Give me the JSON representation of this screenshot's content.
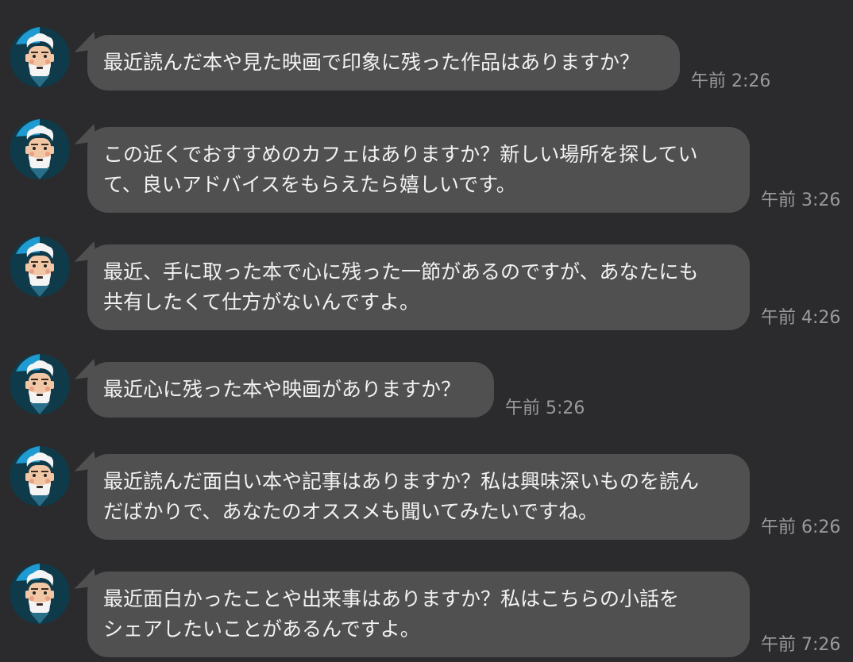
{
  "messages": [
    {
      "lines": [
        "最近読んだ本や見た映画で印象に残った作品はありますか？"
      ],
      "time": "午前 2:26"
    },
    {
      "lines": [
        "この近くでおすすめのカフェはありますか？新しい場所を探してい",
        "て、良いアドバイスをもらえたら嬉しいです。"
      ],
      "time": "午前 3:26"
    },
    {
      "lines": [
        "最近、手に取った本で心に残った一節があるのですが、あなたにも",
        "共有したくて仕方がないんですよ。"
      ],
      "time": "午前 4:26"
    },
    {
      "lines": [
        "最近心に残った本や映画がありますか？"
      ],
      "time": "午前 5:26"
    },
    {
      "lines": [
        "最近読んだ面白い本や記事はありますか？私は興味深いものを読ん",
        "だばかりで、あなたのオススメも聞いてみたいですね。"
      ],
      "time": "午前 6:26"
    },
    {
      "lines": [
        "最近面白かったことや出来事はありますか？私はこちらの小話を",
        "シェアしたいことがあるんですよ。"
      ],
      "time": "午前 7:26"
    }
  ],
  "avatar_icon": "old-man-avatar-icon",
  "colors": {
    "background": "#2b2b2d",
    "bubble": "#505050",
    "text": "#f2f2f2",
    "timestamp": "#9a9a9a",
    "avatar_bg": "#0f3a4a",
    "avatar_accent": "#1f9bd1"
  }
}
